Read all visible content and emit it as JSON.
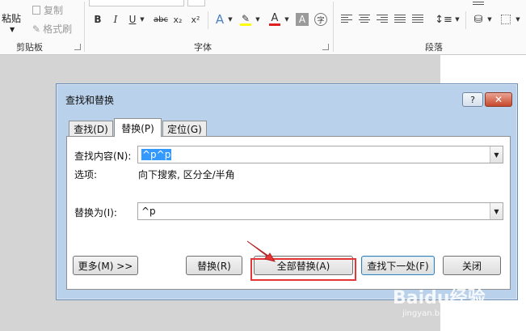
{
  "ribbon": {
    "clipboard": {
      "paste_label": "粘贴",
      "copy_label": "复制",
      "format_painter_label": "格式刷",
      "group_label": "剪贴板"
    },
    "font": {
      "group_label": "字体",
      "buttons": [
        "B",
        "I",
        "U",
        "abc",
        "x₂",
        "x²"
      ],
      "text_effects_glyph": "A",
      "font_color_glyph": "A",
      "char_shading_glyph": "A",
      "phonetic_glyph": "字",
      "highlight_color": "#ffff00",
      "font_color": "#e02020"
    },
    "paragraph": {
      "group_label": "段落"
    }
  },
  "dialog": {
    "title": "查找和替换",
    "help_label": "?",
    "close_label": "✕",
    "tabs": [
      {
        "label": "查找(D)",
        "active": false
      },
      {
        "label": "替换(P)",
        "active": true
      },
      {
        "label": "定位(G)",
        "active": false
      }
    ],
    "find_label": "查找内容(N):",
    "find_value": "^p^p",
    "options_label": "选项:",
    "options_value": "向下搜索, 区分全/半角",
    "replace_label": "替换为(I):",
    "replace_value": "^p",
    "buttons": {
      "more": "更多(M) >>",
      "replace": "替换(R)",
      "replace_all": "全部替换(A)",
      "find_next": "查找下一处(F)",
      "close": "关闭"
    }
  },
  "watermark": {
    "line1": "Baidu经验",
    "line2": "jingyan.baidu.com"
  },
  "colors": {
    "annotation": "#e53535",
    "dialog_frame": "#b9d1ea"
  }
}
